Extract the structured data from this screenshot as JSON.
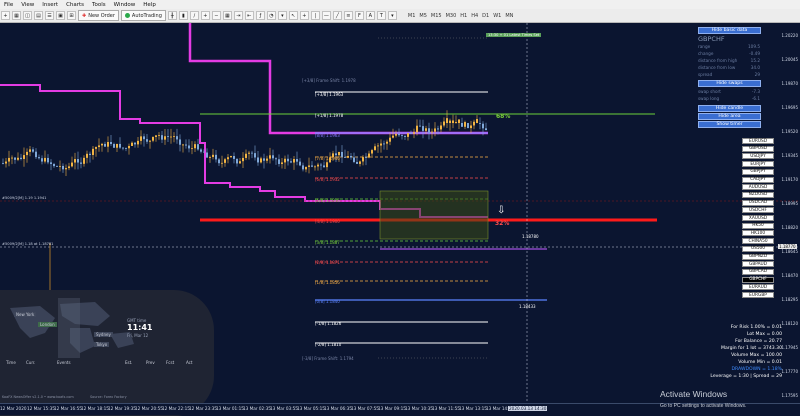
{
  "menu": [
    "File",
    "View",
    "Insert",
    "Charts",
    "Tools",
    "Window",
    "Help"
  ],
  "toolbar": {
    "new_order": "New Order",
    "autotrading": "AutoTrading",
    "timeframes": [
      "M1",
      "M5",
      "M15",
      "M30",
      "H1",
      "H4",
      "D1",
      "W1",
      "MN"
    ]
  },
  "pct_above": "68%",
  "pct_below": "32%",
  "time_tag": "13:30 + 01 Latest Times Set",
  "levels": [
    {
      "label": "[+3/8] 1.1963",
      "color": "#ffffff"
    },
    {
      "label": "[+1/8] 1.1978",
      "color": "#ffffff"
    },
    {
      "label": "[8/8] 1.1963",
      "color": "#8a7cff"
    },
    {
      "label": "[7/8] 1.1946",
      "color": "#ffb347"
    },
    {
      "label": "[6/8] 1.1932",
      "color": "#ff4d4d"
    },
    {
      "label": "[5/8] 1.1916",
      "color": "#7bd13a"
    },
    {
      "label": "[4/8] 1.1900",
      "color": "#ff4d4d"
    },
    {
      "label": "[3/8] 1.1887",
      "color": "#7bd13a"
    },
    {
      "label": "[2/8] 1.1871",
      "color": "#ff4d4d"
    },
    {
      "label": "[1/8] 1.1856",
      "color": "#ffb347"
    },
    {
      "label": "[0/8] 1.1840",
      "color": "#5b84ff"
    },
    {
      "label": "[-1/8] 1.1826",
      "color": "#ffffff"
    },
    {
      "label": "[-2/8] 1.1810",
      "color": "#ffffff"
    }
  ],
  "level_notes": {
    "top": "[+3/8] Frame Shift: 1.1978",
    "bottom": "[-3/8] Frame Shift: 1.1794"
  },
  "price_marks": {
    "upper": "1.18780",
    "lower": "1.18433"
  },
  "left_marks": {
    "upper": "#5009/2[M] 1.19 1.1941",
    "lower": "#5009/2[M] 1.18 at 1.18781"
  },
  "price_scale": [
    "1.20220",
    "1.20045",
    "1.19870",
    "1.19695",
    "1.19520",
    "1.19345",
    "1.19170",
    "1.18995",
    "1.18820",
    "1.18645",
    "1.18470",
    "1.18295",
    "1.18120",
    "1.17945",
    "1.17770",
    "1.17595"
  ],
  "current_price": "1.18770",
  "panel": {
    "hide_basic": "Hide basic data",
    "symbol": "GBPCHF",
    "rows": [
      {
        "k": "range",
        "v": "109.5"
      },
      {
        "k": "change",
        "v": "-0.49"
      },
      {
        "k": "distance from high",
        "v": "15.2"
      },
      {
        "k": "distance from low",
        "v": "34.0"
      },
      {
        "k": "spread",
        "v": "29"
      }
    ],
    "hide_swaps": "Hide swaps",
    "swap_rows": [
      {
        "k": "swap short",
        "v": "-7.3"
      },
      {
        "k": "swap long",
        "v": "-6.1"
      }
    ],
    "hide_candle": "Hide candle",
    "hide_area": "Hide area",
    "show_timer": "Show timer"
  },
  "symbols": [
    "EURUSD",
    "GBPUSD",
    "USDJPY",
    "EURJPY",
    "GBPJPY",
    "CADJPY",
    "AUDUSD",
    "NZDUSD",
    "USDCAD",
    "USDCHF",
    "XAUUSD",
    "HK50",
    "HK100",
    "CHINA50",
    "US500",
    "GBPNZD",
    "GBPAUD",
    "GBPCAD",
    "GBPCHF",
    "EURAUD",
    "EURGBP"
  ],
  "active_symbol": "GBPCHF",
  "risk": [
    "For Risk 1.00% = 0.01",
    "Lot Max = 0.00",
    "For Balance = 20.77",
    "Margin for 1 lot = 3743.30",
    "Volume Max = 100.00",
    "Volume Min = 0.01",
    "DRAWDOWN = 1.18%",
    "Leverage = 1:30 | Spread = 29"
  ],
  "session": {
    "labels": [
      "New York",
      "London",
      "Sydney",
      "Tokyo"
    ],
    "clock_title": "GMT time",
    "clock": "11:41",
    "clock_sub": "Fri, Mar 12",
    "bottom_labels": [
      "Time",
      "Curr.",
      "Events",
      "Est.",
      "Prev",
      "Fcst",
      "Act"
    ]
  },
  "copyright": "KoaFX NewsOffer v2.1.0  •  www.koafx.com",
  "source": "Source: Forex Factory",
  "xaxis": [
    "12 Mar 2020",
    "12 Mar 15:35",
    "12 Mar 16:55",
    "12 Mar 18:15",
    "12 Mar 19:35",
    "12 Mar 20:55",
    "12 Mar 22:15",
    "12 Mar 23:35",
    "13 Mar 01:15",
    "13 Mar 02:35",
    "13 Mar 03:55",
    "13 Mar 05:15",
    "13 Mar 06:35",
    "13 Mar 07:55",
    "13 Mar 09:15",
    "13 Mar 10:35",
    "13 Mar 11:55",
    "13 Mar 13:15",
    "13 Mar 14:35"
  ],
  "xaxis_marker": "2020.03.13 14:30",
  "watermark": {
    "title": "Activate Windows",
    "sub": "Go to PC settings to activate Windows."
  }
}
